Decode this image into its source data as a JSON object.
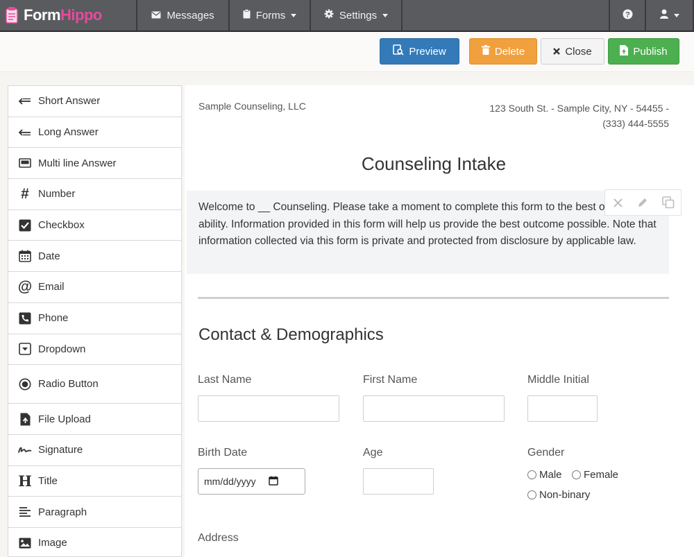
{
  "nav": {
    "logo_part1": "Form",
    "logo_part2": "Hippo",
    "messages": "Messages",
    "forms": "Forms",
    "settings": "Settings"
  },
  "toolbar": {
    "preview": "Preview",
    "delete": "Delete",
    "close": "Close",
    "publish": "Publish"
  },
  "sidebar": {
    "items": [
      {
        "label": "Short Answer",
        "icon": "short-answer-icon"
      },
      {
        "label": "Long Answer",
        "icon": "long-answer-icon"
      },
      {
        "label": "Multi line Answer",
        "icon": "multiline-icon"
      },
      {
        "label": "Number",
        "icon": "hash-icon"
      },
      {
        "label": "Checkbox",
        "icon": "checkbox-icon"
      },
      {
        "label": "Date",
        "icon": "calendar-icon"
      },
      {
        "label": "Email",
        "icon": "at-icon"
      },
      {
        "label": "Phone",
        "icon": "phone-icon"
      },
      {
        "label": "Dropdown",
        "icon": "dropdown-icon"
      },
      {
        "label": "Radio Button",
        "icon": "radio-icon"
      },
      {
        "label": "File Upload",
        "icon": "file-upload-icon"
      },
      {
        "label": "Signature",
        "icon": "signature-icon"
      },
      {
        "label": "Title",
        "icon": "title-icon"
      },
      {
        "label": "Paragraph",
        "icon": "paragraph-icon"
      },
      {
        "label": "Image",
        "icon": "image-icon"
      }
    ]
  },
  "form": {
    "company": "Sample Counseling, LLC",
    "address_line1": "123 South St. - Sample City, NY - 54455 -",
    "address_line2": "(333) 444-5555",
    "title": "Counseling Intake",
    "intro": "Welcome to __ Counseling. Please take a moment to complete this form to the best of your ability. Information provided in this form will help us provide the best outcome possible. Note that information collected via this form is private and protected from disclosure by applicable law.",
    "section_title": "Contact & Demographics",
    "labels": {
      "last_name": "Last Name",
      "first_name": "First Name",
      "middle_initial": "Middle Initial",
      "birth_date": "Birth Date",
      "age": "Age",
      "gender": "Gender",
      "address": "Address"
    },
    "birth_date_placeholder": "mm/dd/yyyy",
    "gender_options": [
      "Male",
      "Female",
      "Non-binary"
    ]
  }
}
